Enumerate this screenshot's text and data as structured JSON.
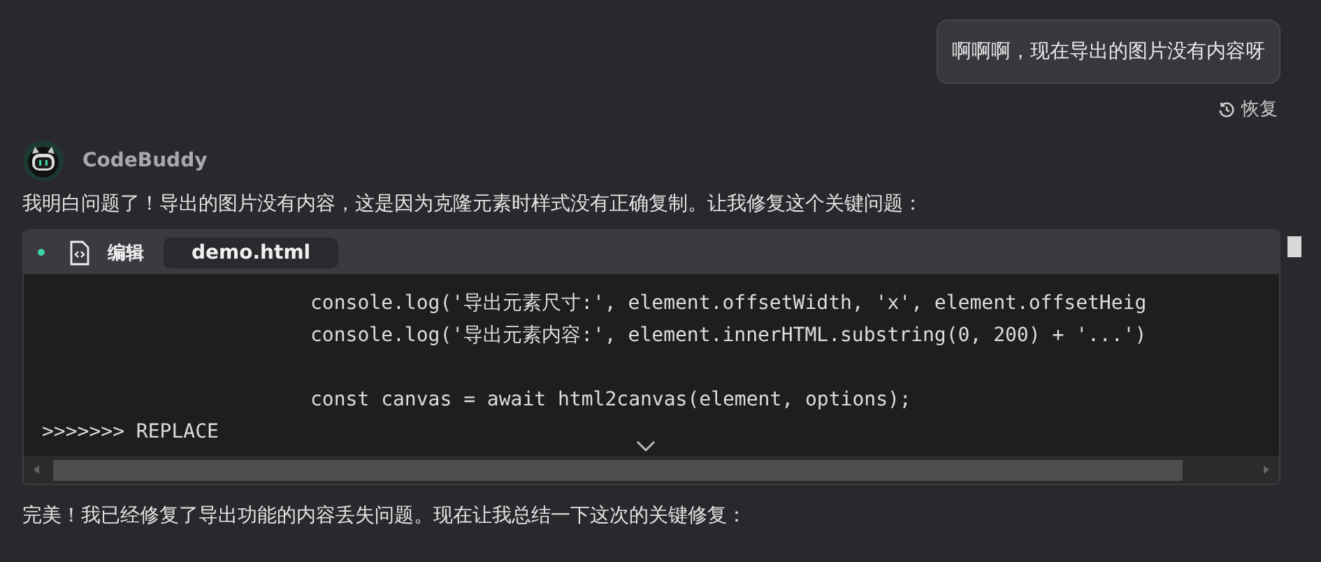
{
  "user_message": {
    "text": "啊啊啊，现在导出的图片没有内容呀",
    "restore_label": "恢复"
  },
  "assistant": {
    "name": "CodeBuddy",
    "intro": "我明白问题了！导出的图片没有内容，这是因为克隆元素时样式没有正确复制。让我修复这个关键问题：",
    "code_block": {
      "action": "编辑",
      "file": "demo.html",
      "lines": [
        {
          "kind": "code",
          "indented": true,
          "text": "console.log('导出元素尺寸:', element.offsetWidth, 'x', element.offsetHeig"
        },
        {
          "kind": "code",
          "indented": true,
          "text": "console.log('导出元素内容:', element.innerHTML.substring(0, 200) + '...')"
        },
        {
          "kind": "blank"
        },
        {
          "kind": "code",
          "indented": true,
          "text": "const canvas = await html2canvas(element, options);"
        },
        {
          "kind": "code",
          "indented": false,
          "text": ">>>>>>> REPLACE"
        }
      ]
    },
    "summary": "完美！我已经修复了导出功能的内容丢失问题。现在让我总结一下这次的关键修复："
  }
}
